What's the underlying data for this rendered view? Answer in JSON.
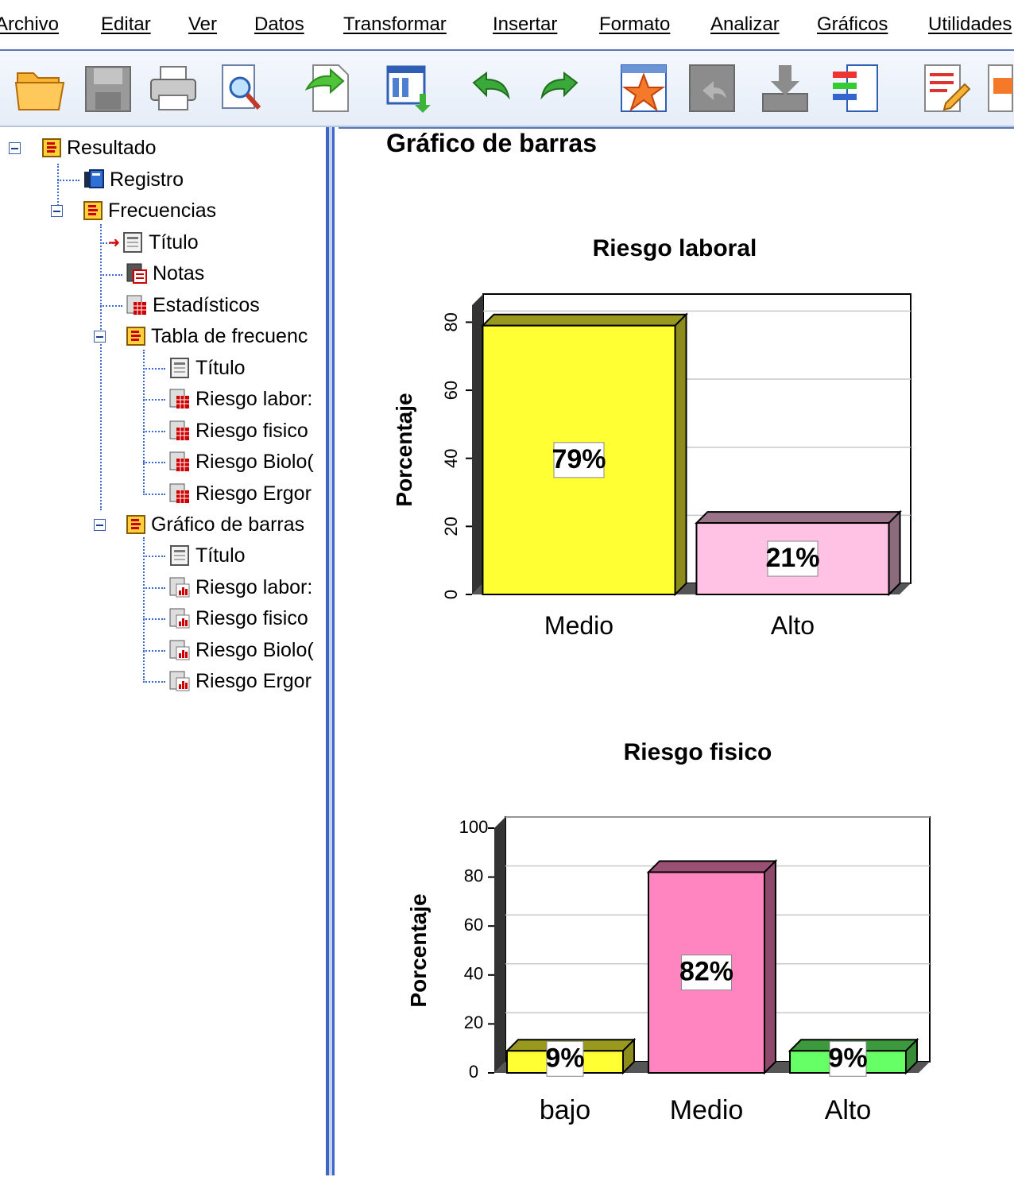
{
  "menu": {
    "items": [
      "Archivo",
      "Editar",
      "Ver",
      "Datos",
      "Transformar",
      "Insertar",
      "Formato",
      "Analizar",
      "Gráficos",
      "Utilidades"
    ]
  },
  "toolbar": {
    "icons": [
      "folder-open-icon",
      "save-icon",
      "print-icon",
      "print-preview-icon",
      "export-icon",
      "insert-output-icon",
      "undo-icon",
      "redo-icon",
      "goto-data-icon",
      "goto-case-icon",
      "goto-variable-icon",
      "variables-icon",
      "new-heading-icon",
      "new-text-icon"
    ]
  },
  "tree": {
    "root": "Resultado",
    "registro": "Registro",
    "frecuencias": "Frecuencias",
    "titulo": "Título",
    "notas": "Notas",
    "estadisticos": "Estadísticos",
    "tabla": "Tabla de frecuenc",
    "tabla_titulo": "Título",
    "tabla_items": [
      "Riesgo labor:",
      "Riesgo fisico",
      "Riesgo Biolo(",
      "Riesgo Ergor"
    ],
    "grafico": "Gráfico de barras",
    "grafico_titulo": "Título",
    "grafico_items": [
      "Riesgo labor:",
      "Riesgo fisico",
      "Riesgo Biolo(",
      "Riesgo Ergor"
    ]
  },
  "content": {
    "heading": "Gráfico de barras"
  },
  "colors": {
    "accent": "#3d67c9",
    "yellow": "#ffff33",
    "pink_light": "#ffc2e4",
    "pink": "#ff85c0",
    "green": "#66ff66"
  },
  "chart_data": [
    {
      "type": "bar",
      "title": "Riesgo laboral",
      "ylabel": "Porcentaje",
      "xlabel": "",
      "categories": [
        "Medio",
        "Alto"
      ],
      "values": [
        79,
        21
      ],
      "labels": [
        "79%",
        "21%"
      ],
      "yticks": [
        0,
        20,
        40,
        60,
        80
      ],
      "ylim": [
        0,
        85
      ],
      "grid": true,
      "colors": [
        "#ffff33",
        "#ffc2e4"
      ]
    },
    {
      "type": "bar",
      "title": "Riesgo fisico",
      "ylabel": "Porcentaje",
      "xlabel": "",
      "categories": [
        "bajo",
        "Medio",
        "Alto"
      ],
      "values": [
        9,
        82,
        9
      ],
      "labels": [
        "9%",
        "82%",
        "9%"
      ],
      "yticks": [
        0,
        20,
        40,
        60,
        80,
        100
      ],
      "ylim": [
        0,
        100
      ],
      "grid": true,
      "colors": [
        "#ffff33",
        "#ff85c0",
        "#66ff66"
      ]
    }
  ]
}
